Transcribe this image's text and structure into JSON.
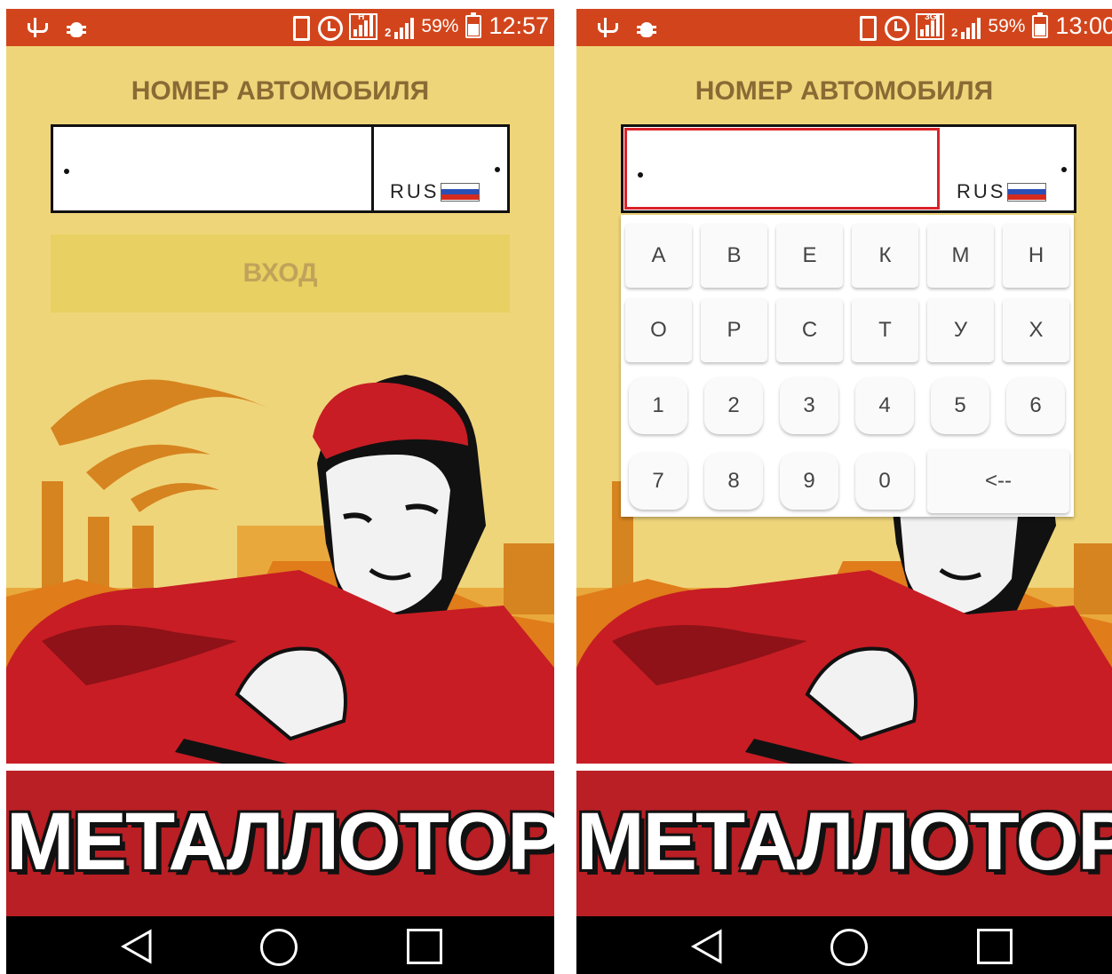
{
  "screens": [
    {
      "status": {
        "battery": "59%",
        "time": "12:57",
        "network": "H",
        "sim": "2"
      },
      "title": "НОМЕР АВТОМОБИЛЯ",
      "plate": {
        "region_label": "RUS"
      },
      "login_button": "ВХОД",
      "brand": "МЕТАЛЛОТОРГ"
    },
    {
      "status": {
        "battery": "59%",
        "time": "13:00",
        "network": "3G",
        "sim": "2"
      },
      "title": "НОМЕР АВТОМОБИЛЯ",
      "plate": {
        "region_label": "RUS"
      },
      "keypad": {
        "letters": [
          "А",
          "В",
          "Е",
          "К",
          "М",
          "Н",
          "О",
          "Р",
          "С",
          "Т",
          "У",
          "Х"
        ],
        "digits": [
          "1",
          "2",
          "3",
          "4",
          "5",
          "6",
          "7",
          "8",
          "9",
          "0"
        ],
        "backspace": "<--"
      },
      "brand": "МЕТАЛЛОТОРГ"
    }
  ],
  "colors": {
    "status_bar": "#d2451c",
    "background": "#efd57a",
    "title": "#8a6a34",
    "button": "#e8d062",
    "button_text": "#c2a25a",
    "brand_band": "#b91f24",
    "focus_border": "#d8232a"
  },
  "icons": [
    "usb-icon",
    "debug-icon",
    "vibrate-icon",
    "alarm-icon",
    "signal-icon",
    "battery-icon",
    "nav-back-icon",
    "nav-home-icon",
    "nav-recent-icon",
    "russia-flag-icon"
  ]
}
